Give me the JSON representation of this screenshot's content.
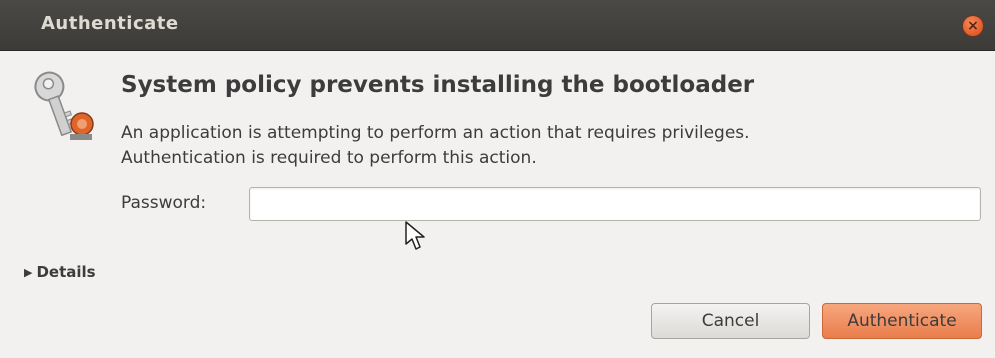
{
  "window": {
    "title": "Authenticate",
    "close_icon": "close-icon"
  },
  "dialog": {
    "icon": "keys-icon",
    "heading": "System policy prevents installing the bootloader",
    "message_line1": "An application is attempting to perform an action that requires privileges.",
    "message_line2": "Authentication is required to perform this action."
  },
  "password": {
    "label": "Password:",
    "value": ""
  },
  "details": {
    "label": "Details",
    "icon": "triangle-right-icon"
  },
  "buttons": {
    "cancel": "Cancel",
    "authenticate": "Authenticate"
  },
  "colors": {
    "titlebar": "#3c3b37",
    "title_text": "#dfdbd2",
    "accent": "#ea7d4c",
    "background": "#f2f1f0"
  }
}
